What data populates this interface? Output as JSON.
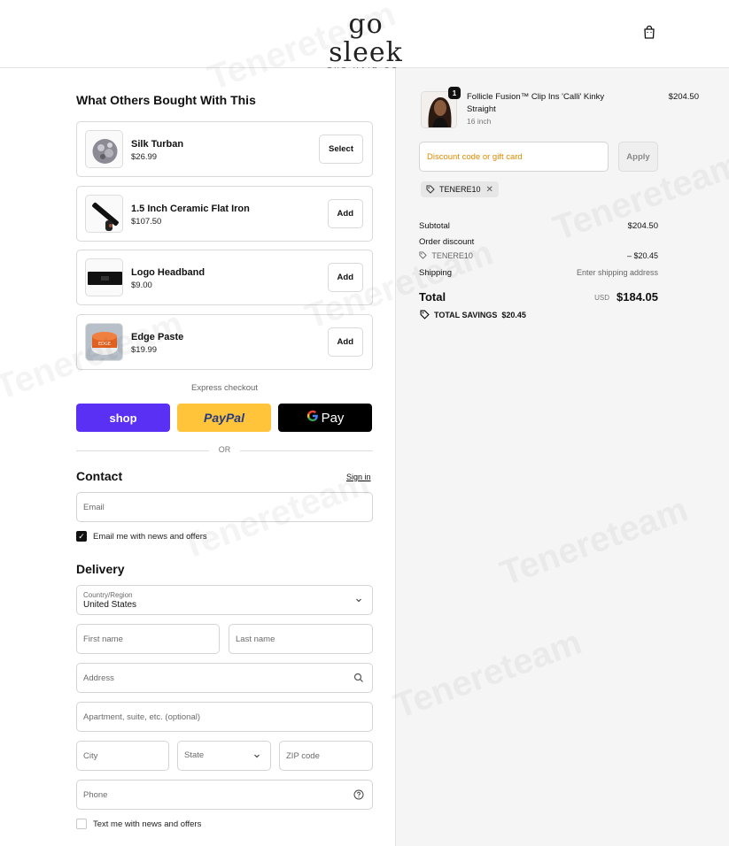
{
  "header": {
    "logo_main": "go sleek",
    "logo_sub": "THE HAIR CO.",
    "cart_icon": "shopping-bag-icon"
  },
  "upsell": {
    "title": "What Others Bought With This",
    "items": [
      {
        "name": "Silk Turban",
        "price": "$26.99",
        "action": "Select"
      },
      {
        "name": "1.5 Inch Ceramic Flat Iron",
        "price": "$107.50",
        "action": "Add"
      },
      {
        "name": "Logo Headband",
        "price": "$9.00",
        "action": "Add"
      },
      {
        "name": "Edge Paste",
        "price": "$19.99",
        "action": "Add"
      }
    ]
  },
  "express": {
    "label": "Express checkout",
    "shop": "shop",
    "paypal": "PayPal",
    "gpay": "Pay",
    "or": "OR"
  },
  "contact": {
    "title": "Contact",
    "sign_in": "Sign in",
    "email_placeholder": "Email",
    "news_checkbox": "Email me with news and offers",
    "news_checked": true
  },
  "delivery": {
    "title": "Delivery",
    "country_label": "Country/Region",
    "country_value": "United States",
    "first_name": "First name",
    "last_name": "Last name",
    "address": "Address",
    "apartment": "Apartment, suite, etc. (optional)",
    "city": "City",
    "state": "State",
    "zip": "ZIP code",
    "phone": "Phone",
    "sms_checkbox": "Text me with news and offers",
    "sms_checked": false
  },
  "summary": {
    "product": {
      "name": "Follicle Fusion™ Clip Ins 'Calli' Kinky Straight",
      "variant": "16 inch",
      "price": "$204.50",
      "qty": "1"
    },
    "discount_placeholder": "Discount code or gift card",
    "apply": "Apply",
    "applied_code": "TENERE10",
    "subtotal_label": "Subtotal",
    "subtotal": "$204.50",
    "order_discount_label": "Order discount",
    "discount_code": "TENERE10",
    "discount_amount": "– $20.45",
    "shipping_label": "Shipping",
    "shipping_value": "Enter shipping address",
    "total_label": "Total",
    "currency": "USD",
    "total": "$184.05",
    "savings_label": "TOTAL SAVINGS",
    "savings_amount": "$20.45"
  },
  "watermark": "Tenereteam"
}
